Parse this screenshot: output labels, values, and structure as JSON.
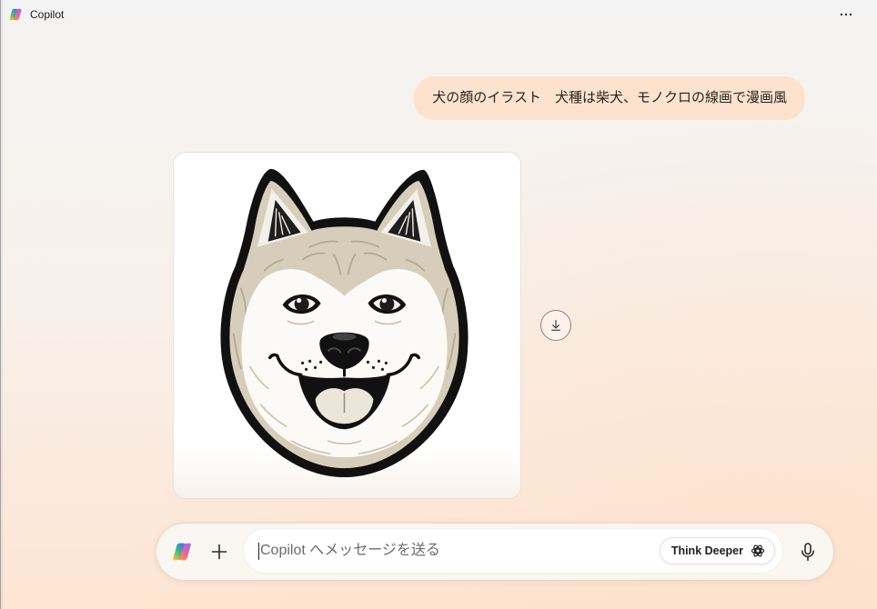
{
  "window": {
    "title": "Copilot",
    "app_icon": "copilot-logo-icon",
    "more_icon": "more-horizontal-icon"
  },
  "conversation": {
    "user_message": {
      "text": "犬の顔のイラスト　犬種は柴犬、モノクロの線画で漫画風"
    },
    "generated_image": {
      "download_icon": "download-icon"
    }
  },
  "composer": {
    "home_icon": "copilot-logo-icon",
    "add_icon": "plus-icon",
    "placeholder": "Copilot へメッセージを送る",
    "value": "",
    "think_deeper_label": "Think Deeper",
    "think_deeper_icon": "think-deeper-icon",
    "mic_icon": "microphone-icon"
  },
  "colors": {
    "user_bubble": "#fde3cd",
    "page_top": "#f3f3f3",
    "page_bottom": "#fde5d2",
    "text": "#242424",
    "placeholder": "#6b6b6b",
    "illustration_fur": "#d6cdbb",
    "illustration_line": "#111111"
  }
}
